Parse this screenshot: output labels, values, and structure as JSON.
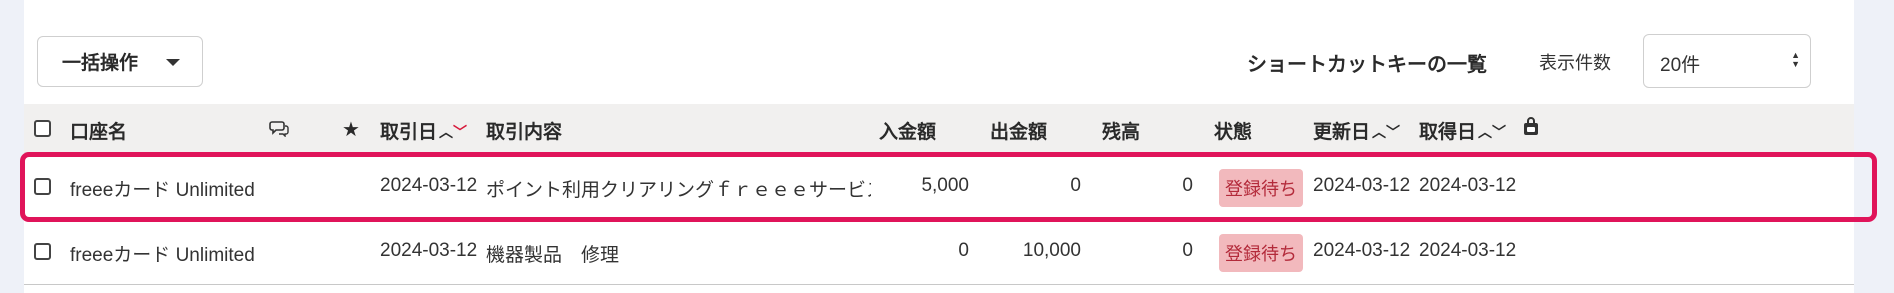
{
  "toolbar": {
    "bulk_action_label": "一括操作",
    "shortcut_label": "ショートカットキーの一覧",
    "per_page_label": "表示件数",
    "per_page_value": "20件"
  },
  "table": {
    "columns": {
      "account": "口座名",
      "date": "取引日",
      "description": "取引内容",
      "deposit": "入金額",
      "withdrawal": "出金額",
      "balance": "残高",
      "status": "状態",
      "updated": "更新日",
      "acquired": "取得日"
    },
    "rows": [
      {
        "account": "freeeカード Unlimited",
        "date": "2024-03-12",
        "description": "ポイント利用クリアリングｆｒｅｅｅサービス利…",
        "deposit": "5,000",
        "withdrawal": "0",
        "balance": "0",
        "status": "登録待ち",
        "updated": "2024-03-12",
        "acquired": "2024-03-12",
        "highlighted": true
      },
      {
        "account": "freeeカード Unlimited",
        "date": "2024-03-12",
        "description": "機器製品　修理",
        "deposit": "0",
        "withdrawal": "10,000",
        "balance": "0",
        "status": "登録待ち",
        "updated": "2024-03-12",
        "acquired": "2024-03-12",
        "highlighted": false
      }
    ]
  },
  "colors": {
    "status_badge_bg": "#f2b9bd",
    "status_badge_text": "#b32a3a",
    "highlight_border": "#e0145a",
    "sort_active": "#d7193a"
  }
}
